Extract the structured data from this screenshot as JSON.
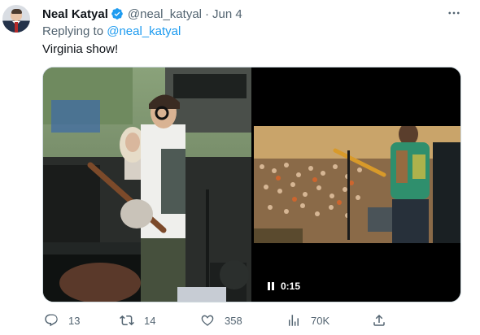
{
  "author": {
    "display_name": "Neal Katyal",
    "handle": "@neal_katyal",
    "separator": "·",
    "date": "Jun 4"
  },
  "reply": {
    "prefix": "Replying to",
    "mention": "@neal_katyal"
  },
  "text": "Virginia show!",
  "video": {
    "duration": "0:15"
  },
  "metrics": {
    "replies": "13",
    "retweets": "14",
    "likes": "358",
    "views": "70K"
  },
  "colors": {
    "accent": "#1d9bf0",
    "secondary_text": "#536471",
    "primary_text": "#0f1419"
  },
  "icons": {
    "verified": "verified-badge-icon",
    "more": "more-icon",
    "reply": "reply-icon",
    "retweet": "retweet-icon",
    "like": "like-icon",
    "views": "views-icon",
    "share": "share-icon",
    "pause": "pause-icon"
  }
}
